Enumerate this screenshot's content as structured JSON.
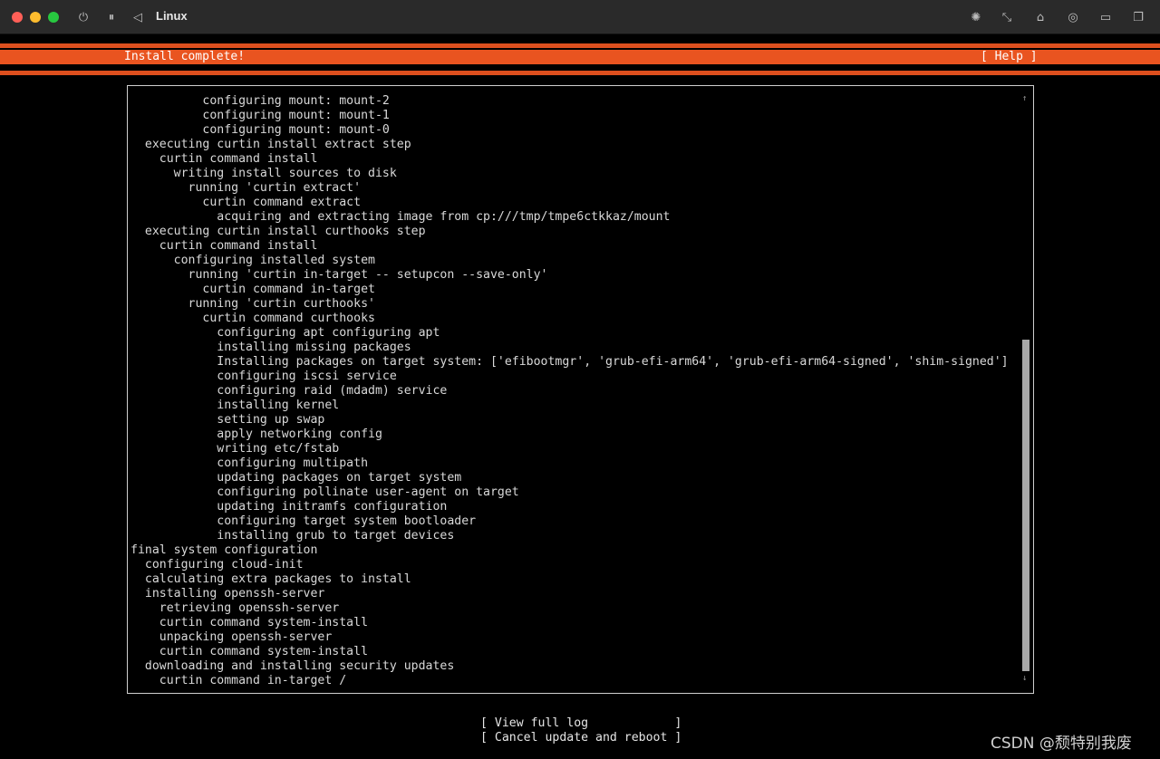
{
  "window": {
    "title": "Linux",
    "icons": {
      "power": "⏻",
      "pause": "⏸",
      "back": "◁",
      "brightness": "✺",
      "resize": "⤡",
      "usb": "⌂",
      "share": "◎",
      "folder": "▭",
      "windows": "❐"
    }
  },
  "installer": {
    "header_title": "Install complete!",
    "help_label": "[ Help ]",
    "accent_color": "#e95420"
  },
  "log": {
    "scroll_up": "↑",
    "scroll_down": "↓",
    "lines": [
      "          configuring mount: mount-2",
      "          configuring mount: mount-1",
      "          configuring mount: mount-0",
      "  executing curtin install extract step",
      "    curtin command install",
      "      writing install sources to disk",
      "        running 'curtin extract'",
      "          curtin command extract",
      "            acquiring and extracting image from cp:///tmp/tmpe6ctkkaz/mount",
      "  executing curtin install curthooks step",
      "    curtin command install",
      "      configuring installed system",
      "        running 'curtin in-target -- setupcon --save-only'",
      "          curtin command in-target",
      "        running 'curtin curthooks'",
      "          curtin command curthooks",
      "            configuring apt configuring apt",
      "            installing missing packages",
      "            Installing packages on target system: ['efibootmgr', 'grub-efi-arm64', 'grub-efi-arm64-signed', 'shim-signed']",
      "            configuring iscsi service",
      "            configuring raid (mdadm) service",
      "            installing kernel",
      "            setting up swap",
      "            apply networking config",
      "            writing etc/fstab",
      "            configuring multipath",
      "            updating packages on target system",
      "            configuring pollinate user-agent on target",
      "            updating initramfs configuration",
      "            configuring target system bootloader",
      "            installing grub to target devices",
      "final system configuration",
      "  configuring cloud-init",
      "  calculating extra packages to install",
      "  installing openssh-server",
      "    retrieving openssh-server",
      "    curtin command system-install",
      "    unpacking openssh-server",
      "    curtin command system-install",
      "  downloading and installing security updates",
      "    curtin command in-target /"
    ]
  },
  "buttons": {
    "view_full_log": "[ View full log            ]",
    "cancel_update": "[ Cancel update and reboot ]"
  },
  "watermark": "CSDN @颓特别我废"
}
